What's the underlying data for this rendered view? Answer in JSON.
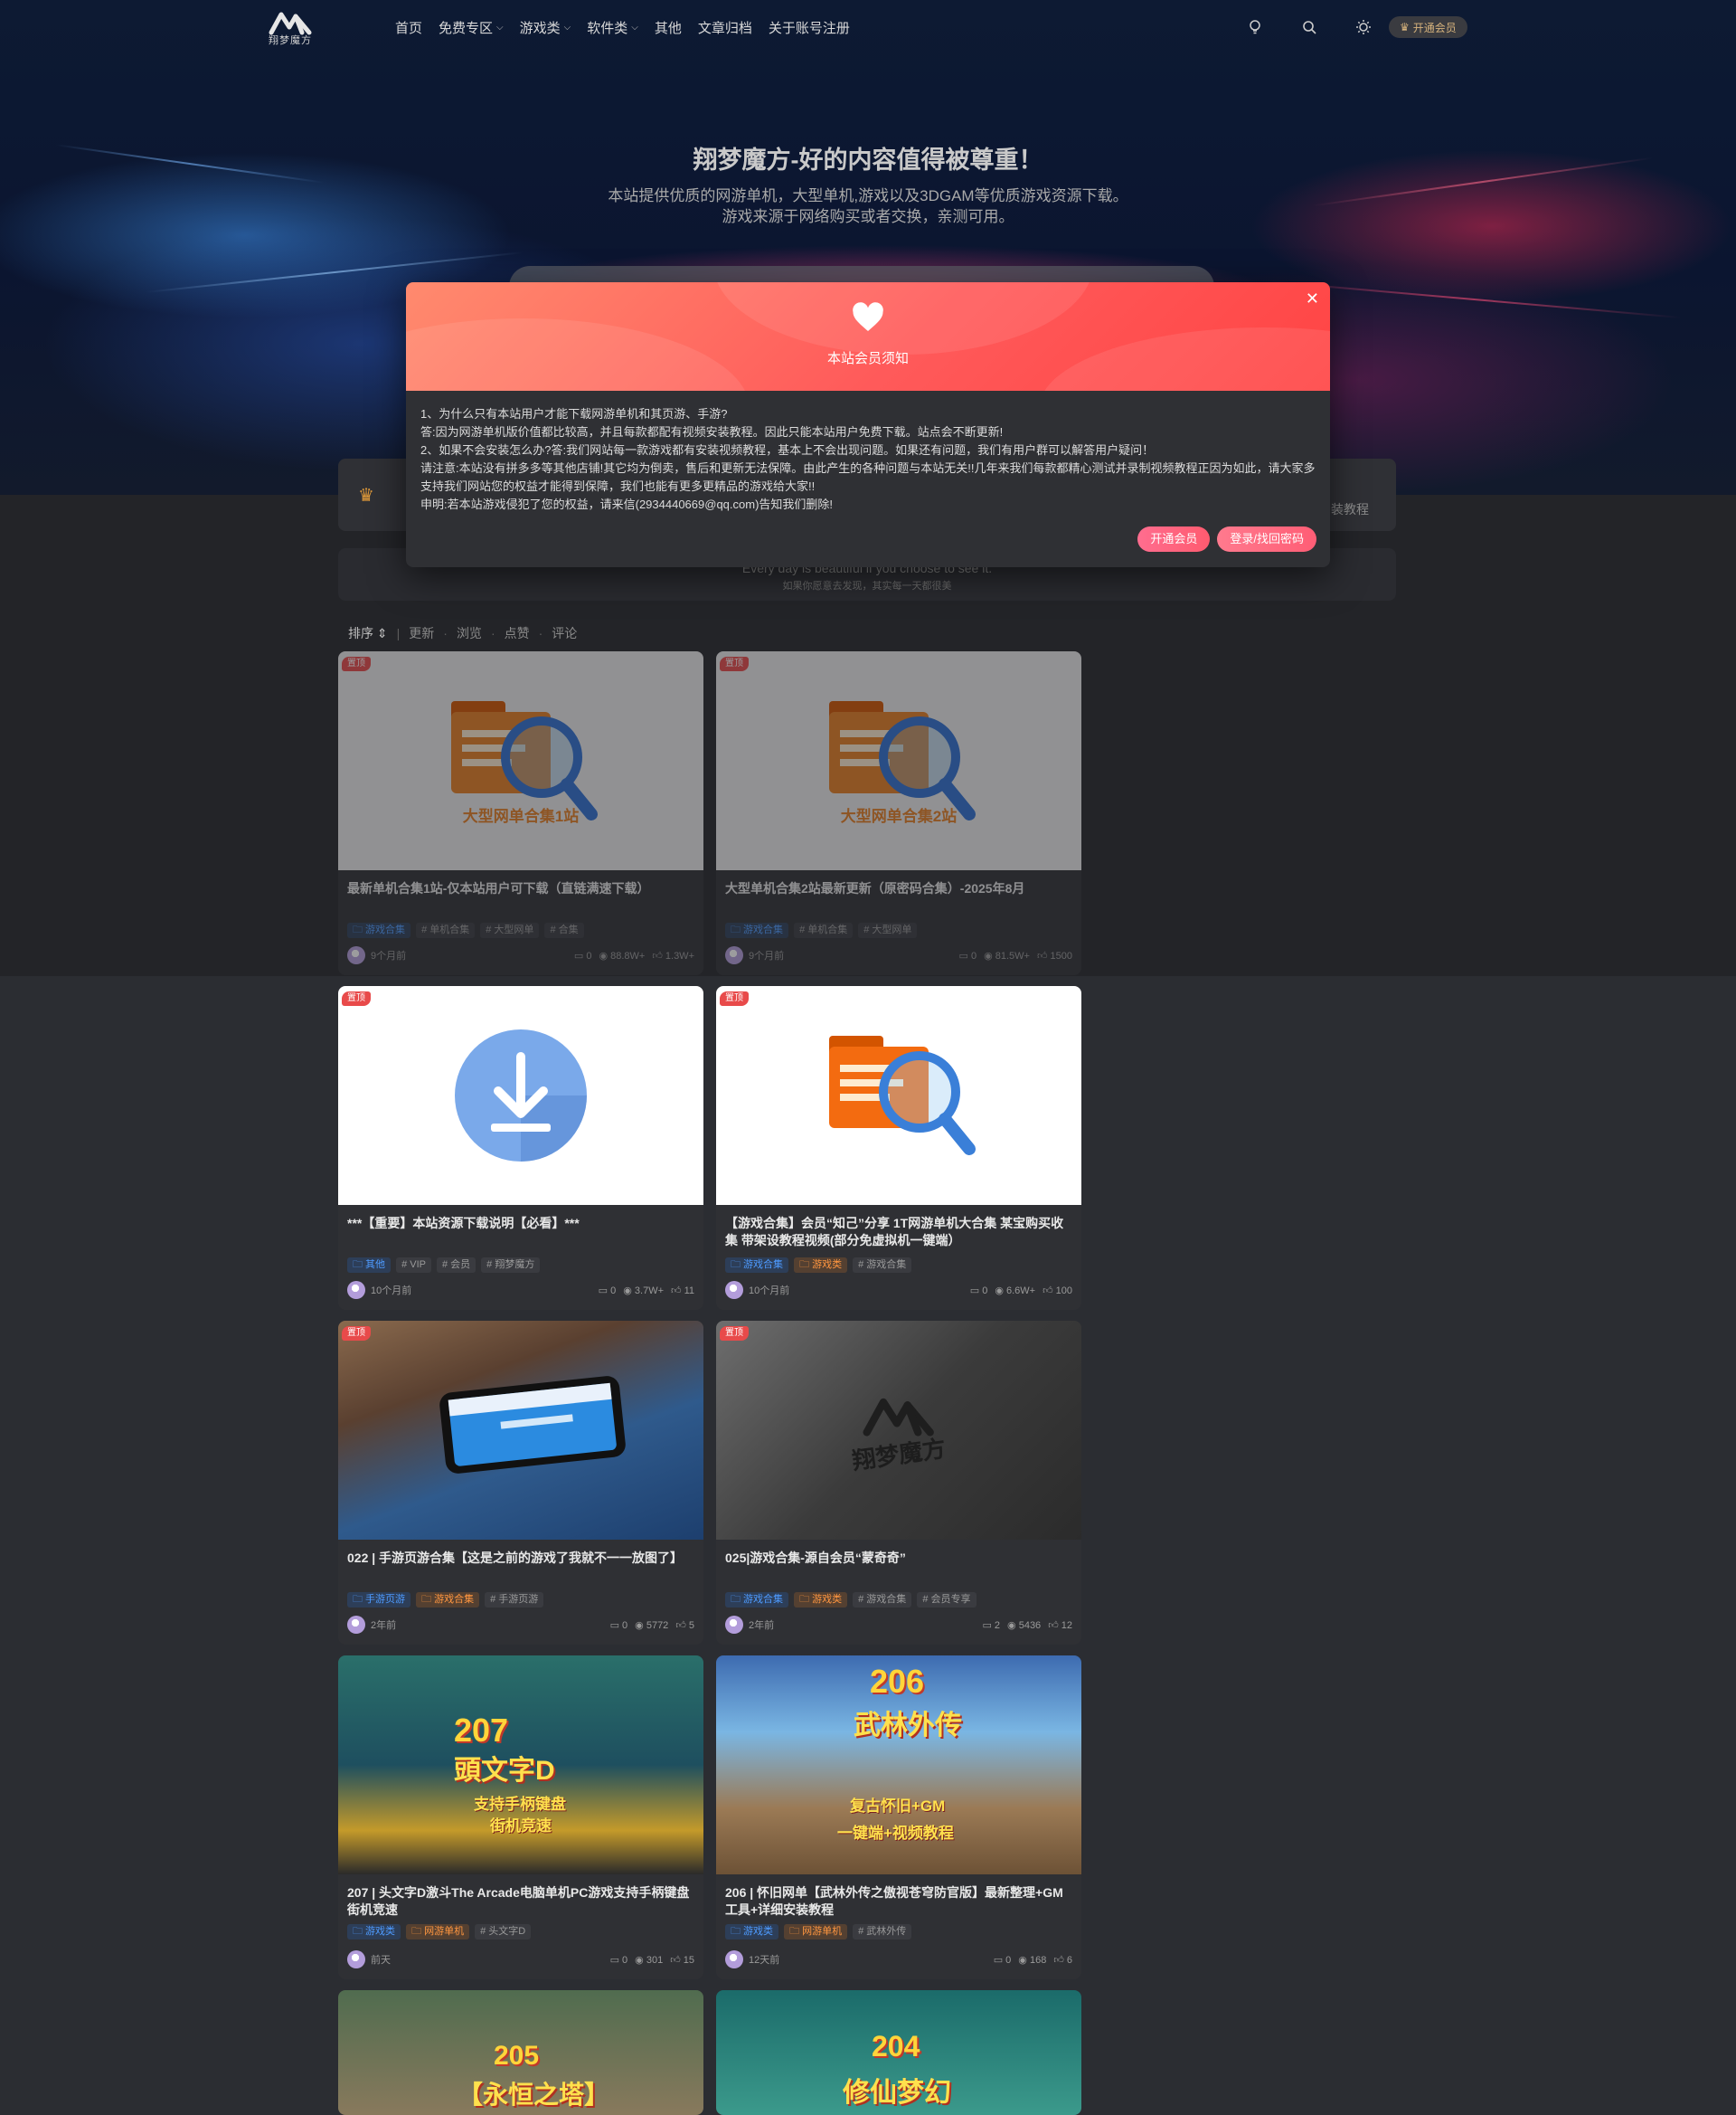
{
  "nav": {
    "logo_text": "翔梦魔方",
    "menu": [
      {
        "label": "首页",
        "dropdown": false
      },
      {
        "label": "免费专区",
        "dropdown": true
      },
      {
        "label": "游戏类",
        "dropdown": true
      },
      {
        "label": "软件类",
        "dropdown": true
      },
      {
        "label": "其他",
        "dropdown": false
      },
      {
        "label": "文章归档",
        "dropdown": false
      },
      {
        "label": "关于账号注册",
        "dropdown": false
      }
    ],
    "vip_label": "开通会员"
  },
  "hero": {
    "title": "翔梦魔方-好的内容值得被尊重！",
    "subtitle_1": "本站提供优质的网游单机，大型单机,游戏以及3DGAM等优质游戏资源下载。",
    "subtitle_2": "游戏来源于网络购买或者交换，亲测可用。"
  },
  "notice": {
    "right_text": "装教程"
  },
  "quote": {
    "line_1": "Every day is beautiful if you choose to see it.",
    "line_2": "如果你愿意去发现，其实每一天都很美"
  },
  "sort": {
    "label": "排序",
    "options": [
      "更新",
      "浏览",
      "点赞",
      "评论"
    ]
  },
  "pin_label": "置顶",
  "cards": [
    {
      "title": "最新单机合集1站-仅本站用户可下载（直链满速下载）",
      "thumb_caption": "大型网单合集1站",
      "tags": [
        {
          "text": "游戏合集",
          "style": "blue"
        },
        {
          "text": "# 单机合集",
          "style": "gray"
        },
        {
          "text": "# 大型网单",
          "style": "gray"
        },
        {
          "text": "# 合集",
          "style": "gray"
        }
      ],
      "time": "9个月前",
      "comments": "0",
      "views": "88.8W+",
      "likes": "1.3W+"
    },
    {
      "title": "大型单机合集2站最新更新（原密码合集）-2025年8月",
      "thumb_caption": "大型网单合集2站",
      "tags": [
        {
          "text": "游戏合集",
          "style": "blue"
        },
        {
          "text": "# 单机合集",
          "style": "gray"
        },
        {
          "text": "# 大型网单",
          "style": "gray"
        }
      ],
      "time": "9个月前",
      "comments": "0",
      "views": "81.5W+",
      "likes": "1500"
    },
    {
      "title": "***【重要】本站资源下载说明【必看】***",
      "thumb_caption": "",
      "tags": [
        {
          "text": "其他",
          "style": "blue"
        },
        {
          "text": "# VIP",
          "style": "gray"
        },
        {
          "text": "# 会员",
          "style": "gray"
        },
        {
          "text": "# 翔梦魔方",
          "style": "gray"
        }
      ],
      "time": "10个月前",
      "comments": "0",
      "views": "3.7W+",
      "likes": "11"
    },
    {
      "title": "【游戏合集】会员“知己”分享 1T网游单机大合集 某宝购买收集 带架设教程视频(部分免虚拟机一键端）",
      "thumb_caption": "",
      "tags": [
        {
          "text": "游戏合集",
          "style": "blue"
        },
        {
          "text": "游戏类",
          "style": "orange"
        },
        {
          "text": "# 游戏合集",
          "style": "gray"
        }
      ],
      "time": "10个月前",
      "comments": "0",
      "views": "6.6W+",
      "likes": "100"
    },
    {
      "title": "022 | 手游页游合集【这是之前的游戏了我就不一一放图了】",
      "thumb_caption": "",
      "tags": [
        {
          "text": "手游页游",
          "style": "blue"
        },
        {
          "text": "游戏合集",
          "style": "orange"
        },
        {
          "text": "# 手游页游",
          "style": "gray"
        }
      ],
      "time": "2年前",
      "comments": "0",
      "views": "5772",
      "likes": "5"
    },
    {
      "title": "025|游戏合集-源自会员“蒙奇奇”",
      "thumb_caption": "翔梦魔方",
      "tags": [
        {
          "text": "游戏合集",
          "style": "blue"
        },
        {
          "text": "游戏类",
          "style": "orange"
        },
        {
          "text": "# 游戏合集",
          "style": "gray"
        },
        {
          "text": "# 会员专享",
          "style": "gray"
        }
      ],
      "time": "2年前",
      "comments": "2",
      "views": "5436",
      "likes": "12"
    },
    {
      "title": "207 | 头文字D激斗The Arcade电脑单机PC游戏支持手柄键盘街机竞速",
      "thumb_caption": "",
      "game": {
        "num": "207",
        "line": "頭文字D",
        "small_1": "支持手柄键盘",
        "small_2": "街机竞速"
      },
      "tags": [
        {
          "text": "游戏类",
          "style": "blue"
        },
        {
          "text": "网游单机",
          "style": "orange"
        },
        {
          "text": "# 头文字D",
          "style": "gray"
        }
      ],
      "time": "前天",
      "comments": "0",
      "views": "301",
      "likes": "15"
    },
    {
      "title": "206 | 怀旧网单【武林外传之傲视苍穹防官版】最新整理+GM工具+详细安装教程",
      "thumb_caption": "",
      "game": {
        "num": "206",
        "line": "武林外传",
        "small_1": "复古怀旧+GM",
        "small_2": "一键端+视频教程"
      },
      "tags": [
        {
          "text": "游戏类",
          "style": "blue"
        },
        {
          "text": "网游单机",
          "style": "orange"
        },
        {
          "text": "# 武林外传",
          "style": "gray"
        }
      ],
      "time": "12天前",
      "comments": "0",
      "views": "168",
      "likes": "6"
    },
    {
      "title": "",
      "thumb_caption": "",
      "game": {
        "num": "205",
        "line": "【永恒之塔】",
        "small_1": "",
        "small_2": ""
      }
    },
    {
      "title": "",
      "thumb_caption": "",
      "game": {
        "num": "204",
        "line": "修仙梦幻",
        "small_1": "",
        "small_2": ""
      }
    }
  ],
  "modal": {
    "title": "本站会员须知",
    "lines": [
      "1、为什么只有本站用户才能下载网游单机和其页游、手游?",
      "答:因为网游单机版价值都比较高，并且每款都配有视频安装教程。因此只能本站用户免费下载。站点会不断更新!",
      "2、如果不会安装怎么办?答:我们网站每一款游戏都有安装视频教程，基本上不会出现问题。如果还有问题，我们有用户群可以解答用户疑问！",
      "请注意:本站没有拼多多等其他店铺!其它均为倒卖，售后和更新无法保障。由此产生的各种问题与本站无关!!几年来我们每款都精心测试并录制视频教程正因为如此，请大家多支持我们网站您的权益才能得到保障，我们也能有更多更精品的游戏给大家!!",
      "申明:若本站游戏侵犯了您的权益，请来信(2934440669@qq.com)告知我们删除!"
    ],
    "btn_vip": "开通会员",
    "btn_login": "登录/找回密码"
  },
  "colors": {
    "accent_pink": "#ff5b6f",
    "tag_blue": "#4e9bff",
    "tag_orange": "#ff9640",
    "pin_red": "#e84a4a"
  }
}
